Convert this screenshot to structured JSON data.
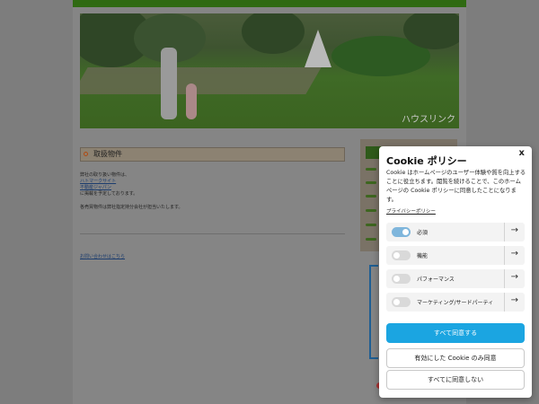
{
  "background_page": {
    "hero_watermark": "ハウスリンク",
    "section_title": "取扱物件",
    "intro_line": "弊社の取り扱い物件は、",
    "link1": "ハトマークサイト",
    "link2": "不動産ジャパン",
    "after_links": "に掲載を予定しております。",
    "note": "各売買物件は弊社指定持分会社が担当いたします。",
    "contact_link": "お問い合わせはこちら"
  },
  "cookie": {
    "title": "Cookie ポリシー",
    "close_label": "x",
    "description": "Cookie はホームページのユーザー体験や質を向上することに役立ちます。閲覧を続けることで、このホームページの Cookie ポリシーに同意したことになります。",
    "privacy_link": "プライバシーポリシー",
    "categories": [
      {
        "label": "必須",
        "enabled": true
      },
      {
        "label": "機能",
        "enabled": false
      },
      {
        "label": "パフォーマンス",
        "enabled": false
      },
      {
        "label": "マーケティング/サードパーティ",
        "enabled": false
      }
    ],
    "accept_all": "すべて同意する",
    "accept_enabled": "有効にした Cookie のみ同意",
    "reject_all": "すべてに同意しない",
    "arrow_icon": "chevron-right-icon",
    "accent_color": "#1ba5e1"
  }
}
